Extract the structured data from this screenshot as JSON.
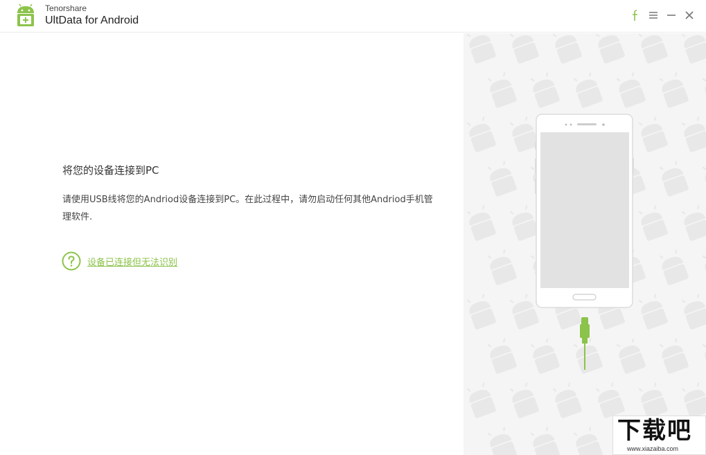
{
  "titlebar": {
    "brand": "Tenorshare",
    "app_name": "UltData for Android"
  },
  "colors": {
    "accent": "#8cc34a",
    "text_primary": "#333333",
    "background_right": "#f5f5f5"
  },
  "icons": {
    "logo": "android-data-icon",
    "facebook": "facebook-icon",
    "menu": "menu-icon",
    "minimize": "minimize-icon",
    "close": "close-icon",
    "help": "question-circle-icon",
    "phone": "phone-illustration",
    "cable": "usb-cable-icon"
  },
  "main": {
    "heading": "将您的设备连接到PC",
    "description": "请使用USB线将您的Andriod设备连接到PC。在此过程中，请勿启动任何其他Andriod手机管理软件.",
    "help_link": "设备已连接但无法识别"
  },
  "watermark": {
    "title": "下载吧",
    "url": "www.xiazaiba.com"
  }
}
